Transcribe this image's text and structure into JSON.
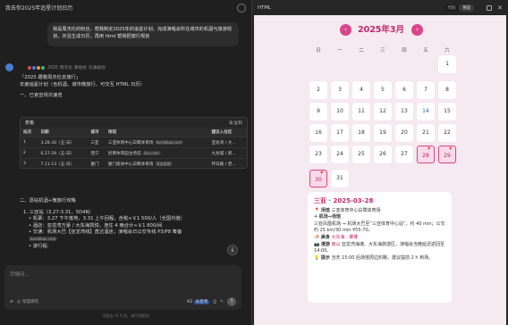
{
  "left": {
    "window_title": "我去你2025年追星计划日历",
    "user_message": "我是周杰伦的粉丝，帮我制定2025年的追星计划，完成演唱会所在城市的机酒与旅游规划，并且生成日历，再用 html 帮我把旅行规划",
    "sources_label": "2025 周杰伦 演唱会 交通规划",
    "answer_intro_1": "「2025 跟着周杰伦去旅行」",
    "answer_intro_2": "年度追星计划（含机酒、城市微旅行、可交互 HTML 日历）",
    "section_1": "一、已官宣场次速览",
    "table": {
      "label": "表格",
      "copy_label": "复制",
      "headers": [
        "站次",
        "日期",
        "城市",
        "场馆",
        "建议入住区"
      ],
      "rows": [
        [
          "1",
          "3.28-30（五-日）",
          "三亚",
          "三亚体育中心白鹭体育场",
          "bendibao.com",
          "亚龙湾 / 大..."
        ],
        [
          "2",
          "6.27-29（五-日）",
          "西宁",
          "奶茶体育园主场馆",
          "lizu.com",
          "九龙城 / 新..."
        ],
        [
          "3",
          "7.11-13（五-日）",
          "厦门",
          "厦门奥体中心白鹭体育场",
          "家居家颜",
          "环岛路 / 曾..."
        ]
      ]
    },
    "section_2": "二、逐站机酒+微旅行攻略",
    "route": {
      "stop_title": "1. 三亚站（3.27-3.31，5D4N）",
      "flight": "• 机票：3.27 下午落地，3.31 上午回程，含税≈￥1 500/人（全国均值）",
      "hotel": "• 酒店：亚龙湾万豪 / 大东海凯悦，连住 4 晚合计≈￥1 800/间",
      "traffic": "• 交通：机场大巴【亚龙湾线】直达酒店；演唱会日公交专线 P3/P8 筹备",
      "traffic_chip": "bendibao.com",
      "tour": "• 游行程:"
    },
    "input_placeholder": "尽情问...",
    "tool_deep_think": "深度研究",
    "model_name": "K2",
    "model_badge": "长思考",
    "disclaimer": "内容由 AI 生成，请仔细甄别"
  },
  "right": {
    "title": "HTML",
    "toggle_code": "代码",
    "toggle_preview": "预览",
    "calendar": {
      "month_title": "2025年3月",
      "prev": "‹",
      "next": "›",
      "weekdays": [
        "日",
        "一",
        "二",
        "三",
        "四",
        "五",
        "六"
      ],
      "days": [
        "1",
        "2",
        "3",
        "4",
        "5",
        "6",
        "7",
        "8",
        "9",
        "10",
        "11",
        "12",
        "13",
        "14",
        "15",
        "16",
        "17",
        "18",
        "19",
        "20",
        "21",
        "22",
        "23",
        "24",
        "25",
        "26",
        "27",
        "28",
        "29",
        "30",
        "31"
      ],
      "pin_glyph": "📍"
    },
    "detail": {
      "title": "三亚 · 2025-03-28",
      "venue_label": "场馆",
      "venue": "三亚体育中心白鹭体育场",
      "flight_label": "机场→场馆",
      "flight_text": "三亚凤凰机场 ⇒ 机场大巴至“三亚体育中心站”，约 40 min；公交约 25 km/30 min ¥55-70。",
      "food_label": "美食",
      "food": "大东海 · 椰椰",
      "tour_label": "漫游",
      "tour_hl": "南山",
      "tour_text": "亚龙湾海滩、大东海旅游区，演唱会当晚延迟返回至 14:00。",
      "tip_label": "提示",
      "tip": "当天 15:00 后场馆周边封路，建议提前 2 h 到场。"
    }
  }
}
